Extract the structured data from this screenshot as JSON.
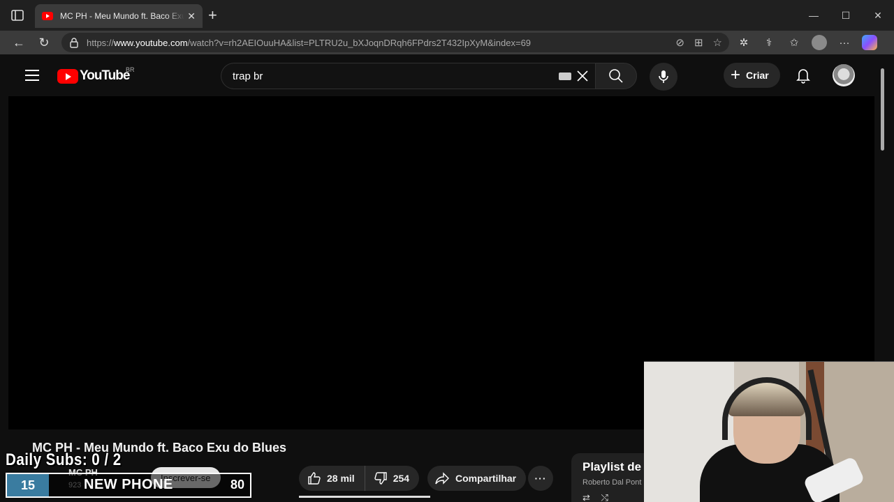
{
  "browser": {
    "tab_title": "MC PH - Meu Mundo ft. Baco Exu do Blues",
    "url_prefix": "https://",
    "url_domain": "www.youtube.com",
    "url_path": "/watch?v=rh2AEIOuuHA&list=PLTRU2u_bXJoqnDRqh6FPdrs2T432IpXyM&index=69",
    "new_tab_label": "+",
    "close_tab_label": "✕"
  },
  "youtube": {
    "logo_text": "YouTube",
    "country_code": "BR",
    "search_value": "trap br",
    "create_label": "Criar"
  },
  "video": {
    "title": "MC PH - Meu Mundo ft. Baco Exu do Blues",
    "channel": "MC PH",
    "subscribers": "923",
    "subscribe_label": "Inscrever-se",
    "likes": "28 mil",
    "dislikes": "254",
    "share_label": "Compartilhar",
    "more_label": "···"
  },
  "playlist": {
    "title": "Playlist de",
    "owner": "Roberto Dal Pont",
    "controls": "⇄ ⤭"
  },
  "overlay": {
    "daily_subs": "Daily Subs:  0 / 2",
    "left_value": "15",
    "middle_text": "NEW PHONE",
    "right_value": "80"
  },
  "colors": {
    "youtube_red": "#ff0000",
    "page_bg": "#0f0f0f",
    "overlay_blue": "#3a7ca0"
  }
}
